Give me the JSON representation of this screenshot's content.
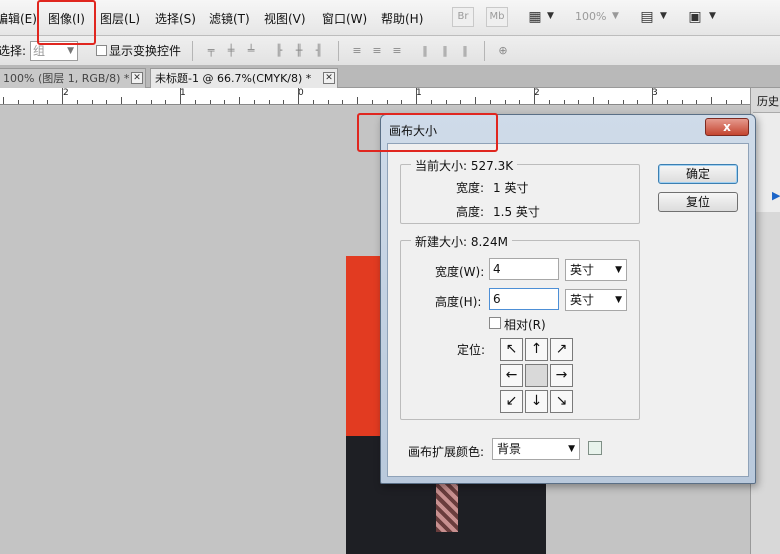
{
  "menubar": {
    "items": [
      "编辑(E)",
      "图像(I)",
      "图层(L)",
      "选择(S)",
      "滤镜(T)",
      "视图(V)",
      "窗口(W)",
      "帮助(H)"
    ],
    "br_label": "Br",
    "mb_label": "Mb",
    "zoom": "100%"
  },
  "options": {
    "select_label": "选择:",
    "select_value": "组",
    "show_transform_label": "显示变换控件"
  },
  "tabs": [
    {
      "label": "100% (图层 1, RGB/8) *"
    },
    {
      "label": "未标题-1 @ 66.7%(CMYK/8) *"
    }
  ],
  "ruler": {
    "numbers": [
      "2",
      "1",
      "0",
      "1",
      "2",
      "3"
    ]
  },
  "history_panel": {
    "label": "历史"
  },
  "dialog": {
    "title": "画布大小",
    "close_label": "x",
    "current_size": {
      "title": "当前大小: 527.3K",
      "width_label": "宽度:",
      "width_value": "1 英寸",
      "height_label": "高度:",
      "height_value": "1.5 英寸"
    },
    "new_size": {
      "title": "新建大小: 8.24M",
      "width_label": "宽度(W):",
      "width_value": "4",
      "width_unit": "英寸",
      "height_label": "高度(H):",
      "height_value": "6",
      "height_unit": "英寸",
      "relative_label": "相对(R)",
      "anchor_label": "定位:"
    },
    "anchor_arrows": [
      "↖",
      "↑",
      "↗",
      "←",
      "",
      "→",
      "↙",
      "↓",
      "↘"
    ],
    "extension_color_label": "画布扩展颜色:",
    "extension_color_value": "背景",
    "ok_label": "确定",
    "reset_label": "复位"
  },
  "colors": {
    "annotation_red": "#e0261f",
    "image_background": "#e23b21",
    "dialog_frame": "#b9c9dc"
  }
}
